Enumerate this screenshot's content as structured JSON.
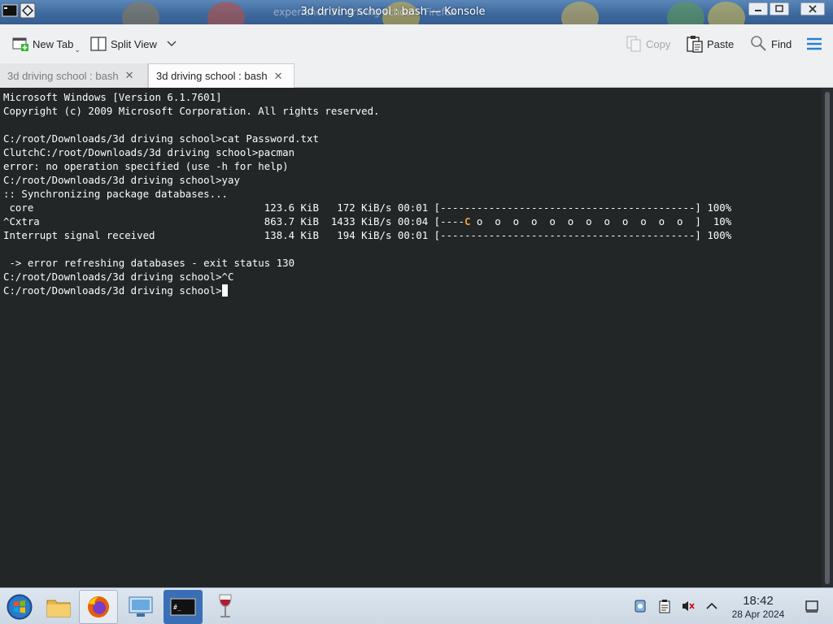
{
  "window": {
    "title": "3d driving school : bash — Konsole",
    "background_title": "experience 3d driving school - Firefox"
  },
  "toolbar": {
    "new_tab_label": "New Tab",
    "split_view_label": "Split View",
    "copy_label": "Copy",
    "paste_label": "Paste",
    "find_label": "Find"
  },
  "tabs": [
    {
      "label": "3d driving school : bash",
      "active": false
    },
    {
      "label": "3d driving school : bash",
      "active": true
    }
  ],
  "terminal": {
    "lines": [
      "Microsoft Windows [Version 6.1.7601]",
      "Copyright (c) 2009 Microsoft Corporation. All rights reserved.",
      "",
      "C:/root/Downloads/3d driving school>cat Password.txt",
      "ClutchC:/root/Downloads/3d driving school>pacman",
      "error: no operation specified (use -h for help)",
      "C:/root/Downloads/3d driving school>yay",
      ":: Synchronizing package databases...",
      " core                                      123.6 KiB   172 KiB/s 00:01 [------------------------------------------] 100%",
      "^Cxtra                                     863.7 KiB  1433 KiB/s 00:04 [----",
      "Interrupt signal received                  138.4 KiB   194 KiB/s 00:01 [------------------------------------------] 100%",
      "",
      " -> error refreshing databases - exit status 130",
      "C:/root/Downloads/3d driving school>^C"
    ],
    "pacman_char": "C",
    "extra_line_tail": " o  o  o  o  o  o  o  o  o  o  o  o  ]  10%",
    "prompt": "C:/root/Downloads/3d driving school>"
  },
  "taskbar": {
    "apps": [
      "start-orb",
      "file-manager",
      "firefox",
      "remote-desktop",
      "terminal",
      "wine"
    ],
    "clock_time": "18:42",
    "clock_date": "28 Apr 2024"
  },
  "colors": {
    "terminal_bg": "#232627",
    "terminal_fg": "#fcfcfc",
    "pacman": "#f0a53a",
    "accent": "#3daee9"
  }
}
